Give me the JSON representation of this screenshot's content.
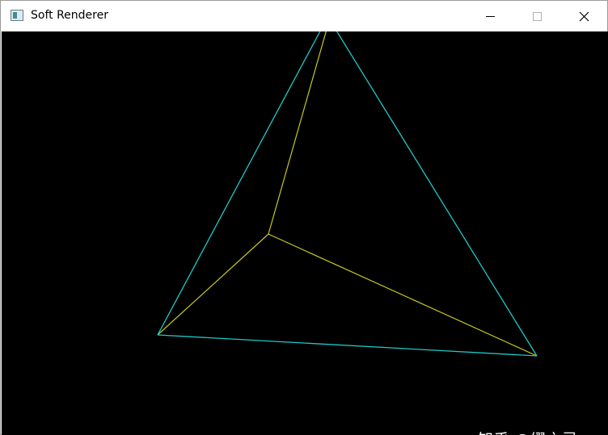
{
  "window": {
    "title": "Soft Renderer",
    "icon": "app-window-icon",
    "controls": {
      "minimize": "minimize-icon",
      "maximize": "maximize-icon",
      "close": "close-icon"
    }
  },
  "scene": {
    "background": "#000000",
    "colors": {
      "outer_edges": "#1fc8c8",
      "inner_edges": "#c8c81e"
    }
  },
  "watermark": {
    "text": "知乎 @缪之灵"
  }
}
